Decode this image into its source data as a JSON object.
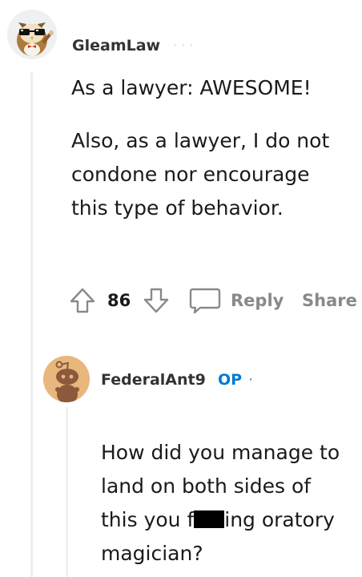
{
  "comment": {
    "username": "GleamLaw",
    "faded_meta": "·   ·   ·",
    "paragraphs": [
      "As a lawyer: AWESOME!",
      "Also, as a lawyer, I do not condone nor encourage this type of behavior."
    ],
    "score": "86",
    "reply_label": "Reply",
    "share_label": "Share",
    "icons": {
      "avatar": "owl-avatar-icon",
      "upvote": "upvote-arrow-icon",
      "downvote": "downvote-arrow-icon",
      "comment": "comment-bubble-icon"
    }
  },
  "reply": {
    "username": "FederalAnt9",
    "op_badge": "OP",
    "separator": "·",
    "text_before": "How did you manage to land on both sides of this you f",
    "text_after": "ing oratory magician?",
    "icons": {
      "avatar": "snoo-avatar-icon",
      "censor": "censor-bar"
    }
  },
  "colors": {
    "op_blue": "#0079d3",
    "meta_gray": "#878a8c",
    "thread_line": "#edeff1",
    "snoo_bg": "#e8b77d"
  }
}
